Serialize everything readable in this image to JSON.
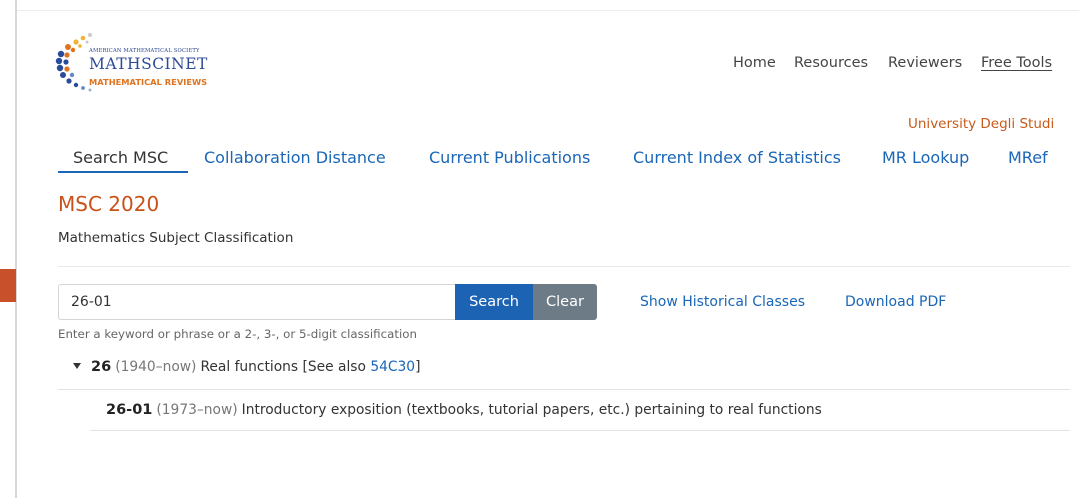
{
  "logo": {
    "society": "AMERICAN MATHEMATICAL SOCIETY",
    "name": "MATHSCINET",
    "subtitle": "MATHEMATICAL REVIEWS",
    "dot_colors": [
      "#2a4a9a",
      "#e0731f",
      "#f2b233",
      "#6a86c4"
    ]
  },
  "topnav": [
    "Home",
    "Resources",
    "Reviewers",
    "Free Tools"
  ],
  "institution": "University Degli Studi",
  "tabs": [
    "Search MSC",
    "Collaboration Distance",
    "Current Publications",
    "Current Index of Statistics",
    "MR Lookup",
    "MRef"
  ],
  "active_tab": "Search MSC",
  "page": {
    "title": "MSC 2020",
    "subtitle": "Mathematics Subject Classification"
  },
  "search": {
    "value": "26-01",
    "search_label": "Search",
    "clear_label": "Clear",
    "helper": "Enter a keyword or phrase or a 2-, 3-, or 5-digit classification"
  },
  "links": {
    "historical": "Show Historical Classes",
    "pdf": "Download PDF"
  },
  "results": {
    "parent": {
      "code": "26",
      "years": "(1940–now)",
      "description": "Real functions [See also ",
      "xref": "54C30",
      "close": "]"
    },
    "child": {
      "code": "26-01",
      "years": "(1973–now)",
      "description": "Introductory exposition (textbooks, tutorial papers, etc.) pertaining to real functions"
    }
  },
  "colors": {
    "accent_orange": "#c8521a",
    "link_blue": "#1a66b7",
    "search_button": "#1d63b3",
    "clear_button": "#6d7b86"
  }
}
